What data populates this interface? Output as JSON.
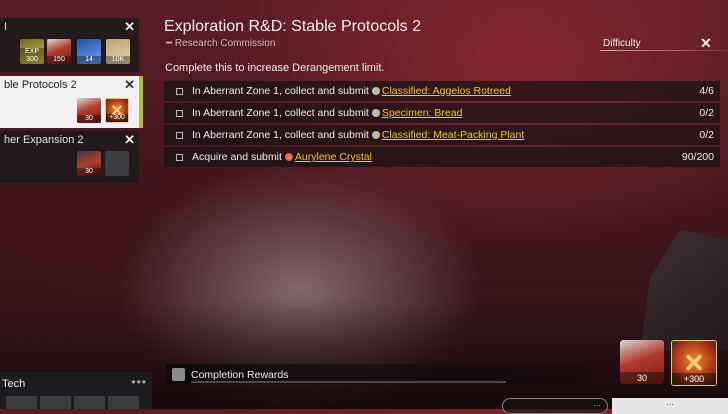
{
  "quest": {
    "title": "Exploration R&D: Stable Protocols 2",
    "subtitle": "Research Commission",
    "difficulty_label": "Difficulty",
    "description": "Complete this to increase Derangement limit."
  },
  "objectives": [
    {
      "prefix": "In Aberrant Zone 1, collect and submit",
      "item": "Classified: Aggelos Rotreed",
      "progress": "4/6",
      "icon": "scroll-icon"
    },
    {
      "prefix": "In Aberrant Zone 1, collect and submit",
      "item": "Specimen: Bread",
      "progress": "0/2",
      "icon": "bread-icon"
    },
    {
      "prefix": "In Aberrant Zone 1, collect and submit",
      "item": "Classified: Meat-Packing Plant",
      "progress": "0/2",
      "icon": "scroll-icon"
    },
    {
      "prefix": "Acquire and submit",
      "item": "Aurylene Crystal",
      "progress": "90/200",
      "icon": "crystal-icon"
    }
  ],
  "commission_list": [
    {
      "title": "I",
      "rewards": [
        "EXP 300",
        "150",
        "14",
        "10K"
      ]
    },
    {
      "title": "ble Protocols 2",
      "rewards": [
        "30",
        "+300"
      ]
    },
    {
      "title": "her Expansion 2",
      "rewards": [
        "30",
        ""
      ]
    }
  ],
  "completion": {
    "label": "Completion Rewards",
    "rewards": [
      "30",
      "+300"
    ]
  },
  "tech": {
    "label": "Tech",
    "dots": "•••"
  },
  "buttons": {
    "secondary_hint": "…",
    "primary_hint": "…"
  },
  "colors": {
    "accent_green": "#a6c437",
    "link_yellow": "#f4c81c",
    "background_red": "#5a1c24"
  }
}
